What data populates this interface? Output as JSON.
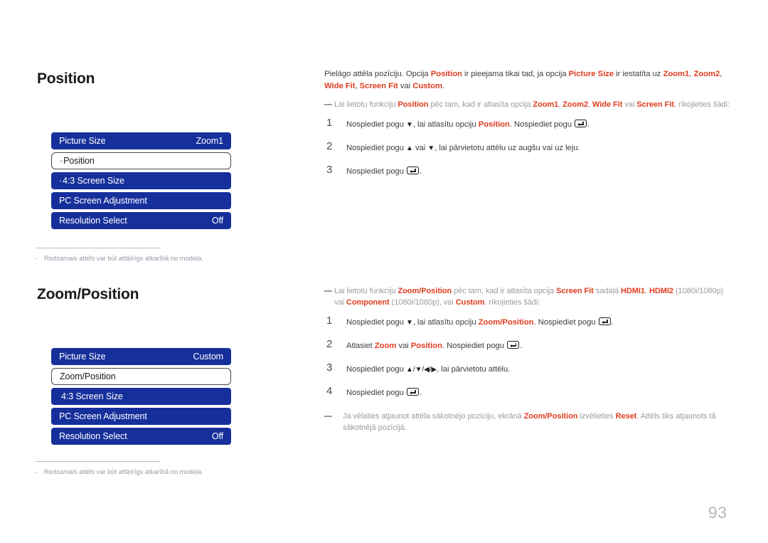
{
  "page": {
    "number": "93",
    "language": "lv"
  },
  "colors": {
    "osd_blue": "#16309b",
    "accent_red": "#e03c1e",
    "body_text": "#3e3e42",
    "note_grey": "#9b9b9b",
    "page_number_grey": "#b6b6bd"
  },
  "sections": [
    {
      "title": "Position",
      "osd_menu": {
        "rows": [
          {
            "label": "Picture Size",
            "value": "Zoom1",
            "selected": false,
            "indent": false
          },
          {
            "label": "Position",
            "value": "",
            "selected": true,
            "indent": true
          },
          {
            "label": "4:3 Screen Size",
            "value": "",
            "selected": false,
            "indent": true
          },
          {
            "label": "PC Screen Adjustment",
            "value": "",
            "selected": false,
            "indent": false
          },
          {
            "label": "Resolution Select",
            "value": "Off",
            "selected": false,
            "indent": false
          }
        ]
      },
      "osd_note": {
        "dash": "-",
        "text": "Redzamais attēls var būt atšķirīgs atkarībā no modeļa."
      },
      "paragraph": {
        "p1_a": "Pielāgo attēla pozīciju. Opcija ",
        "p1_b1": "Position",
        "p1_c": " ir pieejama tikai tad, ja opcija ",
        "p1_b2": "Picture Size",
        "p1_d": " ir iestatīta uz ",
        "p1_b3": "Zoom1",
        "p1_e": ", ",
        "p1_b4": "Zoom2",
        "p1_f": ", ",
        "p1_b5": "Wide Fit",
        "p1_g": ", ",
        "p1_b6": "Screen Fit",
        "p1_h": " vai ",
        "p1_b7": "Custom",
        "p1_i": "."
      },
      "note": {
        "n_a": "Lai lietotu funkciju ",
        "n_b1": "Position",
        "n_c": " pēc tam, kad ir atlasīta opcija ",
        "n_b2": "Zoom1",
        "n_d": ", ",
        "n_b3": "Zoom2",
        "n_e": ", ",
        "n_b4": "Wide Fit",
        "n_f": " vai ",
        "n_b5": "Screen Fit",
        "n_g": ", rīkojieties šādi:"
      },
      "steps": [
        {
          "num": "1",
          "a": "Nospiediet pogu ",
          "arrow1": "▼",
          "b": ", lai atlasītu opciju ",
          "hl": "Position",
          "c": ". Nospiediet pogu ",
          "d": "."
        },
        {
          "num": "2",
          "a": "Nospiediet pogu ",
          "arrow1": "▲",
          "b": " vai ",
          "arrow2": "▼",
          "c": ", lai pārvietotu attēlu uz augšu vai uz leju."
        },
        {
          "num": "3",
          "a": "Nospiediet pogu ",
          "d": "."
        }
      ]
    },
    {
      "title": "Zoom/Position",
      "osd_menu": {
        "rows": [
          {
            "label": "Picture Size",
            "value": "Custom",
            "selected": false,
            "indent": false
          },
          {
            "label": "Zoom/Position",
            "value": "",
            "selected": true,
            "indent": false
          },
          {
            "label": "4:3 Screen Size",
            "value": "",
            "selected": false,
            "indent": false
          },
          {
            "label": "PC Screen Adjustment",
            "value": "",
            "selected": false,
            "indent": false
          },
          {
            "label": "Resolution Select",
            "value": "Off",
            "selected": false,
            "indent": false
          }
        ]
      },
      "osd_note": {
        "dash": "-",
        "text": "Redzamais attēls var būt atšķirīgs atkarībā no modeļa."
      },
      "note": {
        "n_a": "Lai lietotu funkciju ",
        "n_b1": "Zoom/Position",
        "n_c": " pēc tam, kad ir atlasīta opcija ",
        "n_b2": "Screen Fit",
        "n_d": " sadaļā ",
        "n_b3": "HDMI1",
        "n_e": ", ",
        "n_b4": "HDMI2",
        "n_f": " (1080i/1080p) vai ",
        "n_b5": "Component",
        "n_g": " (1080i/1080p), vai ",
        "n_b6": "Custom",
        "n_h": ", rīkojieties šādi:"
      },
      "steps": [
        {
          "num": "1",
          "a": "Nospiediet pogu ",
          "arrow1": "▼",
          "b": ", lai atlasītu opciju ",
          "hl": "Zoom/Position",
          "c": ". Nospiediet pogu ",
          "d": "."
        },
        {
          "num": "2",
          "a": "Atlasiet ",
          "hl": "Zoom",
          "b": " vai ",
          "hl2": "Position",
          "c": ". Nospiediet pogu ",
          "d": "."
        },
        {
          "num": "3",
          "a": "Nospiediet pogu ",
          "arrows": "▲/▼/◀/▶",
          "c": ", lai pārvietotu attēlu."
        },
        {
          "num": "4",
          "a": "Nospiediet pogu ",
          "d": "."
        }
      ],
      "footer_note": {
        "f_a": "Ja vēlaties atjaunot attēla sākotnējo pozīciju, ekrānā ",
        "f_b1": "Zoom/Position",
        "f_c": " izvēlieties ",
        "f_b2": "Reset",
        "f_d": ". Attēls tiks atjaunots tā sākotnējā pozīcijā."
      }
    }
  ]
}
